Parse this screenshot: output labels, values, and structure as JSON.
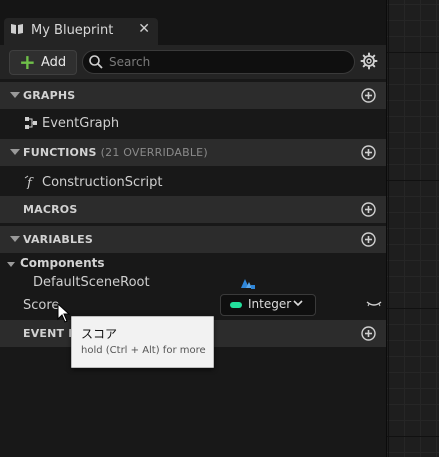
{
  "tab": {
    "title": "My Blueprint",
    "close_glyph": "✕"
  },
  "toolbar": {
    "add_label": "Add",
    "add_glyph": "+",
    "search_placeholder": "Search"
  },
  "sections": {
    "graphs": {
      "title": "GRAPHS"
    },
    "functions": {
      "title": "FUNCTIONS",
      "subtitle": "(21 OVERRIDABLE)"
    },
    "macros": {
      "title": "MACROS"
    },
    "variables": {
      "title": "VARIABLES"
    },
    "event_dispatchers": {
      "title": "EVENT DI"
    }
  },
  "items": {
    "event_graph": "EventGraph",
    "construction_script": "ConstructionScript",
    "components_category": "Components",
    "default_scene_root": "DefaultSceneRoot",
    "score": "Score"
  },
  "score_type": {
    "label": "Integer",
    "color": "#23e09c"
  },
  "tooltip": {
    "title": "スコア",
    "hint": "hold (Ctrl + Alt) for more"
  },
  "colors": {
    "accent_green": "#6fc049",
    "component_blue": "#2f86d8",
    "integer_green": "#23e09c"
  }
}
